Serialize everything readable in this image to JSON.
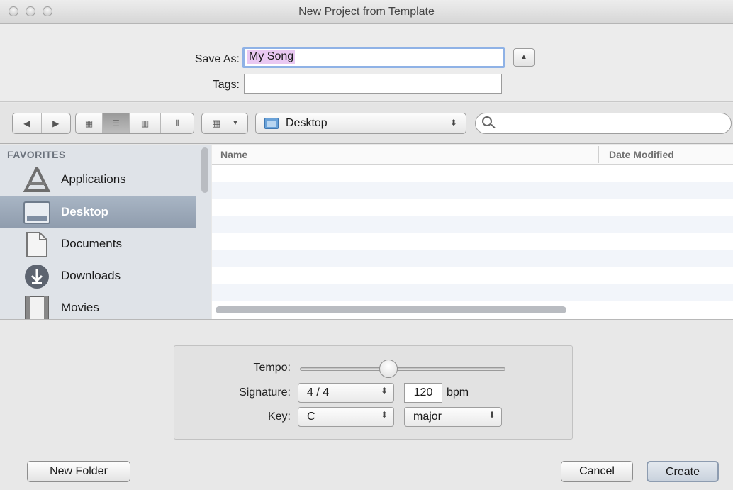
{
  "window": {
    "title": "New Project from Template"
  },
  "save": {
    "save_as_label": "Save As:",
    "save_as_value": "My Song",
    "tags_label": "Tags:",
    "tags_value": ""
  },
  "toolbar": {
    "location": "Desktop",
    "search_value": ""
  },
  "sidebar": {
    "header": "FAVORITES",
    "items": [
      {
        "label": "Applications",
        "icon": "applications-icon",
        "selected": false
      },
      {
        "label": "Desktop",
        "icon": "desktop-icon",
        "selected": true
      },
      {
        "label": "Documents",
        "icon": "documents-icon",
        "selected": false
      },
      {
        "label": "Downloads",
        "icon": "downloads-icon",
        "selected": false
      },
      {
        "label": "Movies",
        "icon": "movies-icon",
        "selected": false
      }
    ]
  },
  "file_list": {
    "columns": [
      "Name",
      "Date Modified"
    ],
    "rows": []
  },
  "project": {
    "tempo_label": "Tempo:",
    "tempo_level": 0.43,
    "signature_label": "Signature:",
    "signature_value": "4 / 4",
    "bpm_value": "120",
    "bpm_unit": "bpm",
    "key_label": "Key:",
    "key_value": "C",
    "mode_value": "major"
  },
  "buttons": {
    "new_folder": "New Folder",
    "cancel": "Cancel",
    "create": "Create"
  },
  "colors": {
    "selection_highlight": "#e9c8f2",
    "sidebar_selected": "#97a4b5",
    "focus_ring": "#8fb2e6"
  }
}
